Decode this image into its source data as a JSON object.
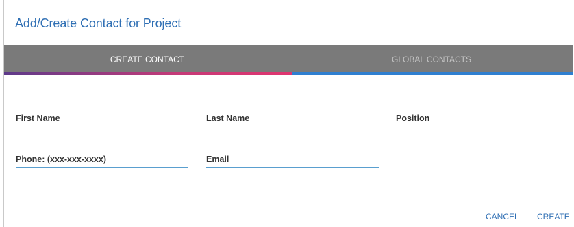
{
  "dialog": {
    "title": "Add/Create Contact for Project"
  },
  "tabs": [
    {
      "label": "CREATE CONTACT",
      "active": true
    },
    {
      "label": "GLOBAL CONTACTS",
      "active": false
    }
  ],
  "form": {
    "first_name": {
      "placeholder": "First Name",
      "value": ""
    },
    "last_name": {
      "placeholder": "Last Name",
      "value": ""
    },
    "position": {
      "placeholder": "Position",
      "value": ""
    },
    "phone": {
      "placeholder": "Phone: (xxx-xxx-xxxx)",
      "value": ""
    },
    "email": {
      "placeholder": "Email",
      "value": ""
    }
  },
  "actions": {
    "cancel_label": "CANCEL",
    "create_label": "CREATE"
  },
  "colors": {
    "accent": "#2f6fb4",
    "tab_bar": "#7a7a7a",
    "active_indicator": "#e0356f",
    "inactive_indicator": "#2f7fd0"
  }
}
